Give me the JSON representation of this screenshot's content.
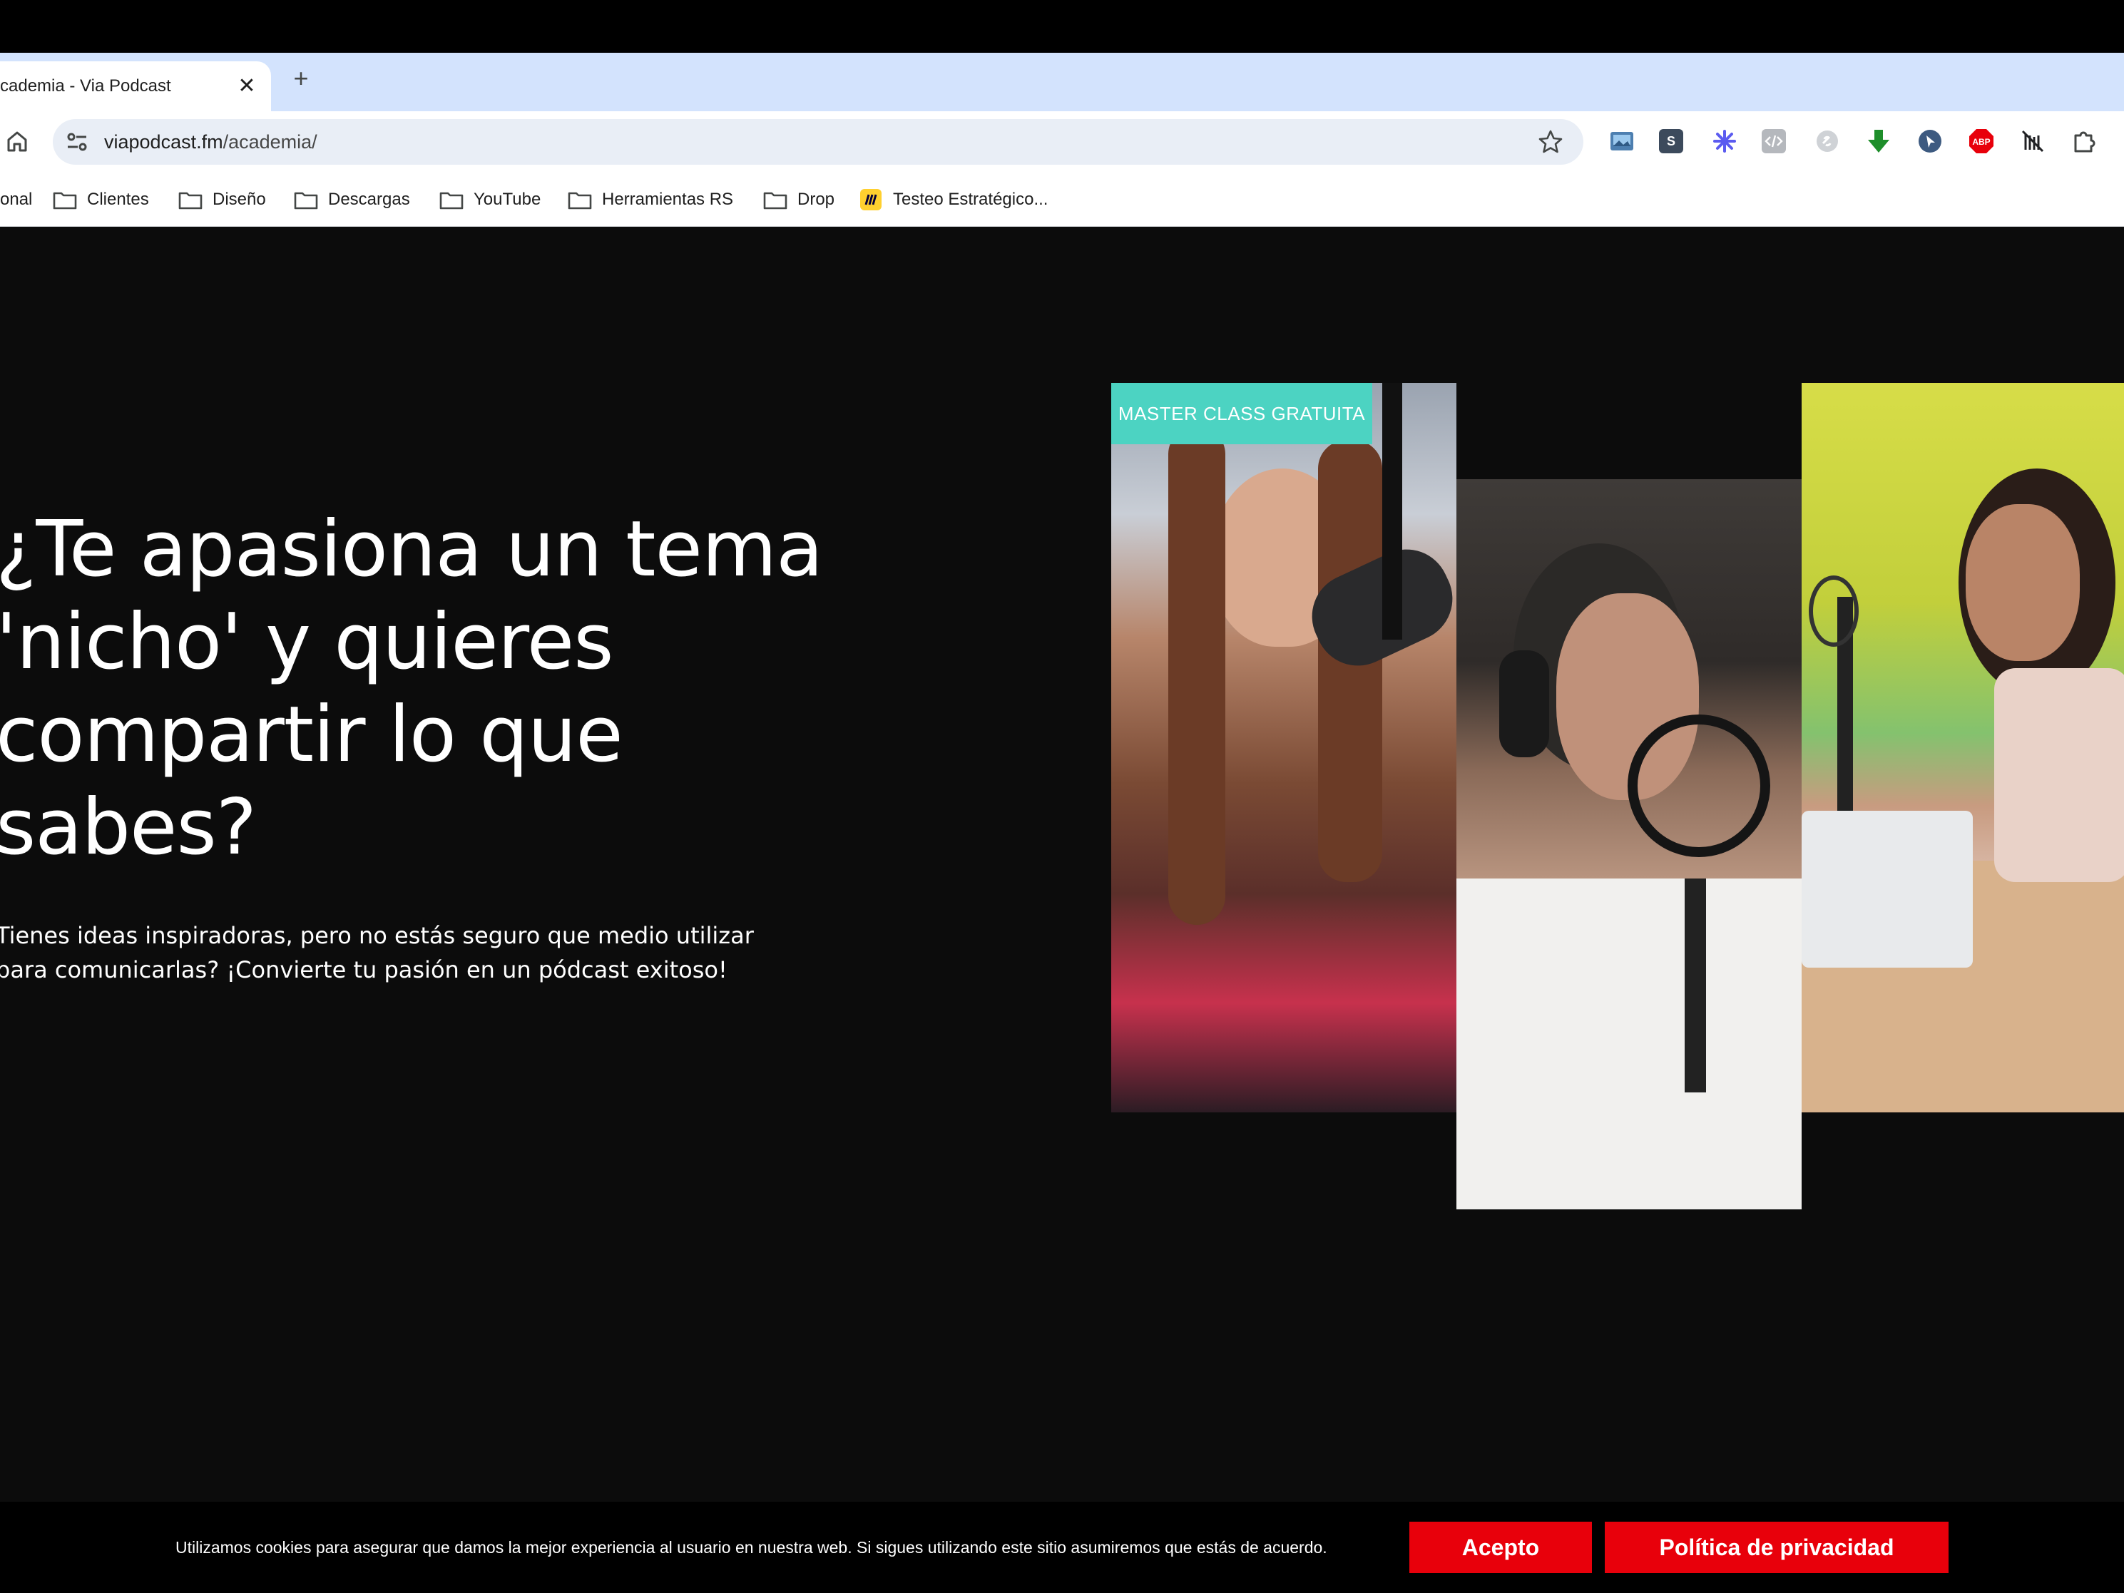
{
  "browser": {
    "tab": {
      "title": "cademia - Via Podcast",
      "close": "✕",
      "new_tab": "+"
    },
    "address": {
      "host": "viapodcast.fm",
      "path": "/academia/"
    },
    "bookmarks": [
      {
        "label": "onal"
      },
      {
        "label": "Clientes"
      },
      {
        "label": "Diseño"
      },
      {
        "label": "Descargas"
      },
      {
        "label": "YouTube"
      },
      {
        "label": "Herramientas RS"
      },
      {
        "label": "Drop"
      },
      {
        "label": "Testeo Estratégico..."
      }
    ],
    "extensions": {
      "s_label": "S",
      "abp_label": "ABP"
    }
  },
  "hero": {
    "title_lines": [
      "¿Te apasiona un tema",
      "'nicho' y quieres",
      "compartir lo que",
      "sabes?"
    ],
    "subtitle_lines": [
      "Tienes ideas inspiradoras, pero no estás seguro que medio utilizar",
      "para comunicarlas? ¡Convierte tu pasión en un pódcast exitoso!"
    ],
    "badge": "MASTER CLASS GRATUITA"
  },
  "cookie": {
    "text": "Utilizamos cookies para asegurar que damos la mejor experiencia al usuario en nuestra web. Si sigues utilizando este sitio asumiremos que estás de acuerdo.",
    "accept": "Acepto",
    "privacy": "Política de privacidad"
  },
  "colors": {
    "page_bg": "#0c0c0c",
    "badge": "#4cd3c2",
    "cookie_button": "#e8000b"
  }
}
